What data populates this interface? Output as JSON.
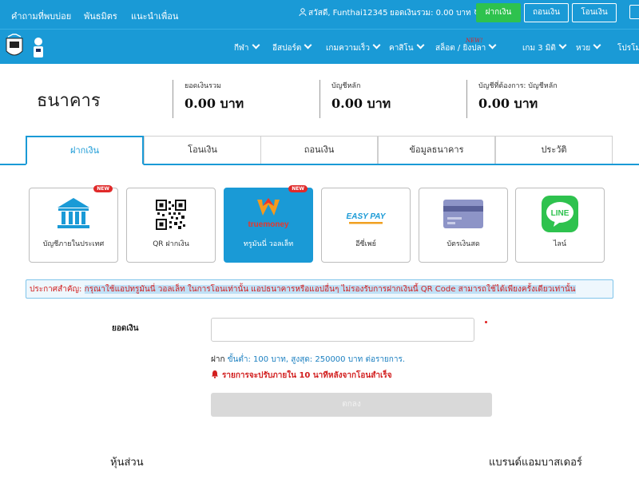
{
  "topbar": {
    "links": [
      "คำถามที่พบบ่อย",
      "พันธมิตร",
      "แนะนำเพื่อน"
    ],
    "greeting": "สวัสดี, Funthai12345",
    "balance_label": "ยอดเงินรวม:",
    "balance_value": "0.00 บาท",
    "deposit_btn": "ฝากเงิน",
    "withdraw_btn": "ถอนเงิน",
    "transfer_btn": "โอนเงิน",
    "accent_color": "#1a9ad6",
    "deposit_color": "#2ec24e"
  },
  "nav": {
    "items": [
      "กีฬา",
      "อีสปอร์ต",
      "เกมความเร็ว",
      "คาสิโน",
      "สล็อต / ยิงปลา",
      "เกม 3 มิติ",
      "หวย",
      "โปรโม"
    ],
    "new_tag": "NEW!"
  },
  "header": {
    "title": "ธนาคาร",
    "summaries": [
      {
        "label": "ยอดเงินรวม",
        "value": "0.00 บาท"
      },
      {
        "label": "บัญชีหลัก",
        "value": "0.00 บาท"
      },
      {
        "label": "บัญชีที่ต้องการ: บัญชีหลัก",
        "value": "0.00 บาท"
      }
    ]
  },
  "tabs": [
    "ฝากเงิน",
    "โอนเงิน",
    "ถอนเงิน",
    "ข้อมูลธนาคาร",
    "ประวัติ"
  ],
  "methods": [
    {
      "label": "บัญชีภายในประเทศ",
      "icon": "bank-icon",
      "badge": "NEW"
    },
    {
      "label": "QR ฝากเงิน",
      "icon": "qr-code-icon",
      "badge": ""
    },
    {
      "label": "ทรูมันนี่ วอลเล็ท",
      "icon": "truemoney-icon",
      "badge": "NEW",
      "logo_text": "truemoney"
    },
    {
      "label": "อีซี่เพย์",
      "icon": "easypay-icon",
      "badge": "",
      "logo_text": "EASY PAY"
    },
    {
      "label": "บัตรเงินสด",
      "icon": "credit-card-icon",
      "badge": ""
    },
    {
      "label": "ไลน์",
      "icon": "line-icon",
      "badge": "",
      "logo_text": "LINE"
    }
  ],
  "announcement": {
    "prefix": "ประกาศสำคัญ: ",
    "text": "กรุณาใช้แอปทรูมันนี่ วอลเล็ท ในการโอนเท่านั้น แอปธนาคารหรือแอปอื่นๆ ไม่รองรับการฝากเงินนี้ QR Code สามารถใช้ได้เพียงครั้งเดียวเท่านั้น"
  },
  "form": {
    "amount_label": "ยอดเงิน",
    "amount_value": "",
    "limit_prefix": "ฝาก ",
    "limit_text": "ขั้นต่ำ: 100 บาท, สูงสุด: 250000 บาท ต่อรายการ.",
    "note": "รายการจะปรับภายใน 10 นาทีหลังจากโอนสำเร็จ",
    "submit": "ตกลง"
  },
  "footer": {
    "left": "หุ้นส่วน",
    "right": "แบรนด์แอมบาสเดอร์"
  }
}
